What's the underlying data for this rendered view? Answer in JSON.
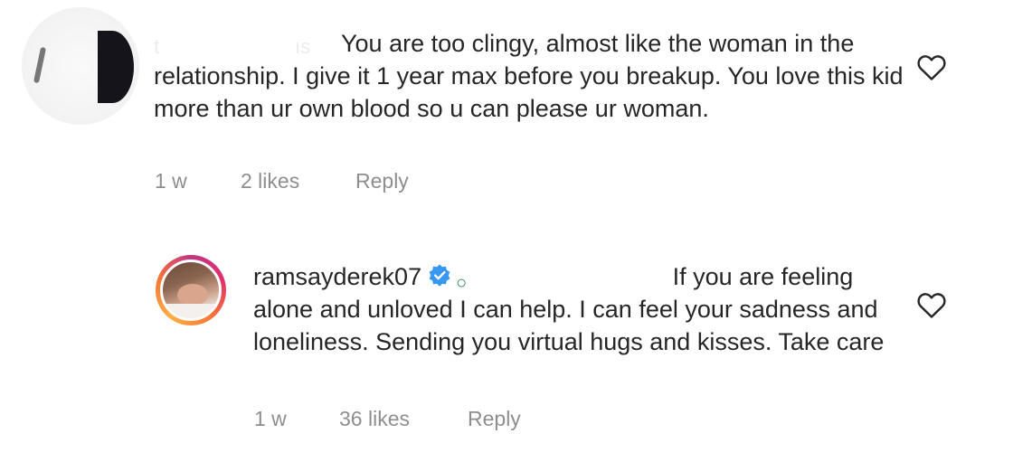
{
  "comments": [
    {
      "username_fragment_start": "t",
      "username_fragment_end": "ıs",
      "text": "You are too clingy, almost like the woman in the relationship. I give it 1 year max before you breakup. You love this kid more than ur own blood so u can please ur woman.",
      "meta": {
        "age": "1 w",
        "likes": "2 likes",
        "reply": "Reply"
      },
      "icons": {
        "like": "heart-outline-icon"
      }
    },
    {
      "username": "ramsayderek07",
      "verified": true,
      "mention_fragment": "○",
      "text": "If you are feeling alone and unloved I can help. I can feel your sadness and loneliness. Sending you virtual hugs and kisses. Take care",
      "meta": {
        "age": "1 w",
        "likes": "36 likes",
        "reply": "Reply"
      },
      "icons": {
        "verified": "verified-badge-icon",
        "like": "heart-outline-icon"
      }
    }
  ],
  "colors": {
    "text": "#262626",
    "meta": "#8e8e8e",
    "verified": "#3897f0"
  }
}
